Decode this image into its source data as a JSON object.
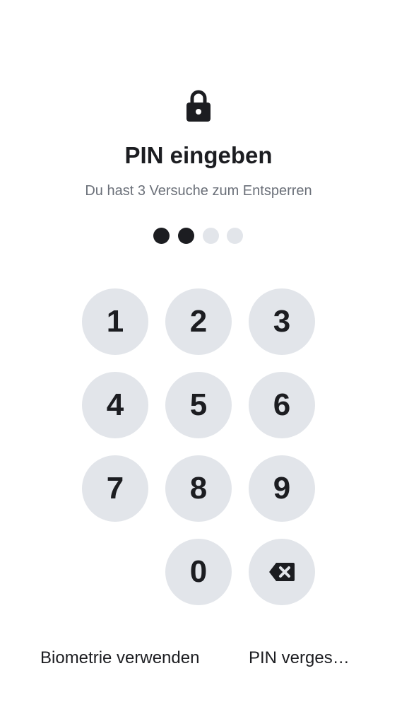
{
  "header": {
    "icon": "lock-icon",
    "title": "PIN eingeben",
    "subtitle": "Du hast 3 Versuche zum Entsperren"
  },
  "pin": {
    "length": 4,
    "entered": 2
  },
  "keypad": {
    "keys": [
      "1",
      "2",
      "3",
      "4",
      "5",
      "6",
      "7",
      "8",
      "9",
      "0"
    ],
    "backspace_icon": "backspace-icon"
  },
  "footer": {
    "biometric_label": "Biometrie verwenden",
    "forgot_label": "PIN verges…"
  },
  "colors": {
    "text": "#1c1d21",
    "muted": "#6b7079",
    "key_background": "#e2e5ea",
    "dot_empty": "#e2e5ea",
    "dot_filled": "#1c1d21"
  }
}
